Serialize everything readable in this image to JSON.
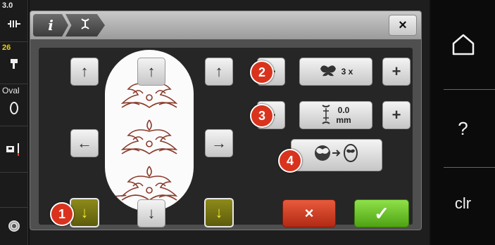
{
  "left_status": {
    "stitch_width": "3.0",
    "stitch_width_icon": "stitch-width-icon",
    "hoop_number": "26",
    "presser_foot_icon": "presser-foot-icon",
    "hoop_label": "Oval",
    "hoop_icon": "oval-hoop-icon",
    "needle_icon": "needle-icon",
    "bobbin_icon": "bobbin-icon"
  },
  "title_tabs": {
    "info_label": "i",
    "info_icon": "info-icon",
    "motif_icon": "motif-repeat-icon"
  },
  "close_label": "×",
  "arrows": {
    "up": "↑",
    "down": "↓",
    "left": "←",
    "right": "→"
  },
  "badges": [
    "1",
    "2",
    "3",
    "4"
  ],
  "repeat_control": {
    "minus": "−",
    "plus": "+",
    "value": "3 x",
    "icon": "butterfly-repeat-icon"
  },
  "spacing_control": {
    "minus": "−",
    "plus": "+",
    "value_line1": "0.0",
    "value_line2": "mm",
    "icon": "motif-spacing-icon"
  },
  "fit_to_hoop": {
    "icon": "butterfly-to-hoop-icon",
    "arrow": "→"
  },
  "cancel_label": "×",
  "confirm_label": "✓",
  "right_panel": {
    "home_icon": "home-icon",
    "help_label": "?",
    "clear_label": "clr"
  },
  "colors": {
    "accent_yellow": "#f3ea2c",
    "badge_red": "#d9331e",
    "cancel_red": "#c23a1e",
    "confirm_green": "#6cc52c"
  }
}
